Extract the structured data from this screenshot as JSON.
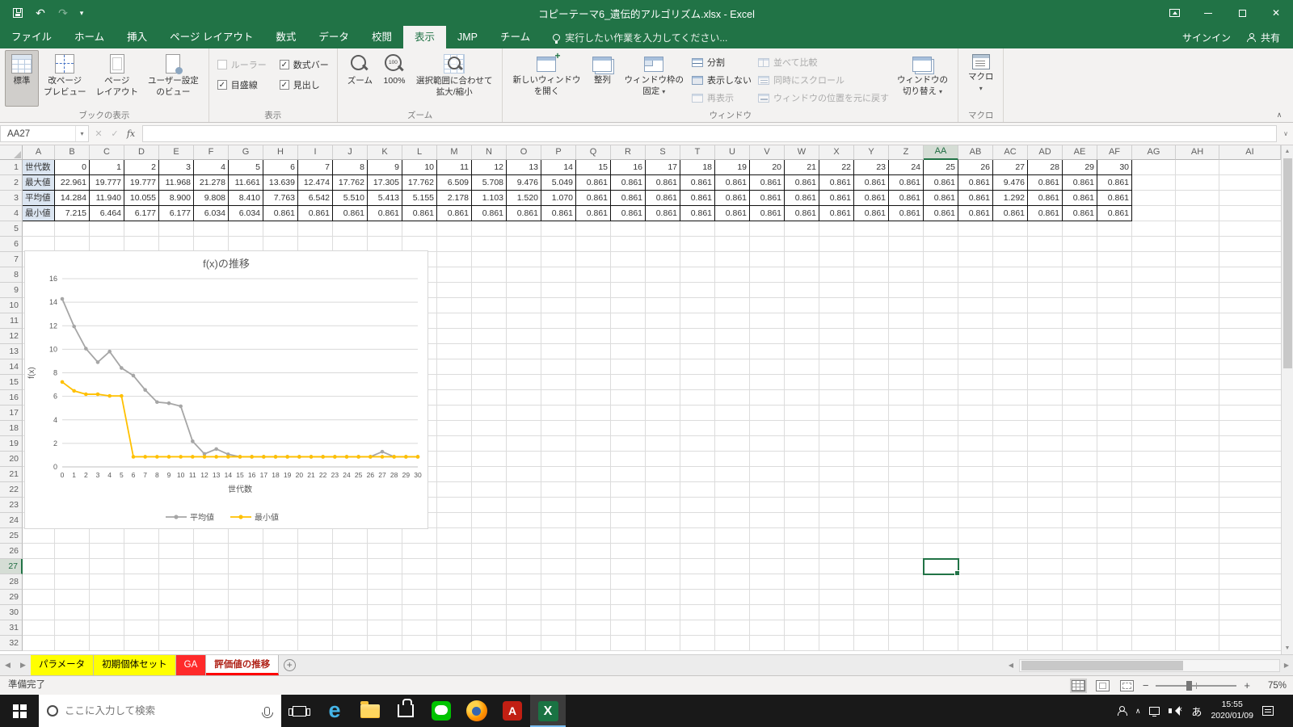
{
  "title_bar": {
    "title": "コピーテーマ6_遺伝的アルゴリズム.xlsx - Excel"
  },
  "ribbon_tabs": {
    "file": "ファイル",
    "home": "ホーム",
    "insert": "挿入",
    "page_layout": "ページ レイアウト",
    "formulas": "数式",
    "data": "データ",
    "review": "校閲",
    "view": "表示",
    "jmp": "JMP",
    "team": "チーム",
    "tell_me": "実行したい作業を入力してください...",
    "sign_in": "サインイン",
    "share": "共有"
  },
  "ribbon": {
    "book_views": {
      "label": "ブックの表示",
      "normal": "標準",
      "page_break_1": "改ページ",
      "page_break_2": "プレビュー",
      "page_layout_1": "ページ",
      "page_layout_2": "レイアウト",
      "custom_1": "ユーザー設定",
      "custom_2": "のビュー"
    },
    "show": {
      "label": "表示",
      "ruler": "ルーラー",
      "formula_bar": "数式バー",
      "gridlines": "目盛線",
      "headings": "見出し"
    },
    "zoom": {
      "label": "ズーム",
      "zoom": "ズーム",
      "hundred": "100%",
      "to_sel_1": "選択範囲に合わせて",
      "to_sel_2": "拡大/縮小"
    },
    "window": {
      "label": "ウィンドウ",
      "new_1": "新しいウィンドウ",
      "new_2": "を開く",
      "arrange": "整列",
      "freeze_1": "ウィンドウ枠の",
      "freeze_2": "固定",
      "split": "分割",
      "hide": "表示しない",
      "unhide": "再表示",
      "side_by_side": "並べて比較",
      "sync_scroll": "同時にスクロール",
      "reset_pos": "ウィンドウの位置を元に戻す",
      "switch_1": "ウィンドウの",
      "switch_2": "切り替え"
    },
    "macros": {
      "label": "マクロ",
      "macros": "マクロ"
    }
  },
  "formula_bar": {
    "name_box": "AA27",
    "formula": ""
  },
  "sheet": {
    "columns": [
      "A",
      "B",
      "C",
      "D",
      "E",
      "F",
      "G",
      "H",
      "I",
      "J",
      "K",
      "L",
      "M",
      "N",
      "O",
      "P",
      "Q",
      "R",
      "S",
      "T",
      "U",
      "V",
      "W",
      "X",
      "Y",
      "Z",
      "AA",
      "AB",
      "AC",
      "AD",
      "AE",
      "AF",
      "AG",
      "AH",
      "AI"
    ],
    "row_count": 32,
    "selected_cell": "AA27",
    "selected_column": "AA",
    "selected_row": 27,
    "table": {
      "header_label": "世代数",
      "row_labels": [
        "最大値",
        "平均値",
        "最小値"
      ],
      "generations": [
        0,
        1,
        2,
        3,
        4,
        5,
        6,
        7,
        8,
        9,
        10,
        11,
        12,
        13,
        14,
        15,
        16,
        17,
        18,
        19,
        20,
        21,
        22,
        23,
        24,
        25,
        26,
        27,
        28,
        29,
        30
      ],
      "values": [
        [
          "22.961",
          "19.777",
          "19.777",
          "11.968",
          "21.278",
          "11.661",
          "13.639",
          "12.474",
          "17.762",
          "17.305",
          "17.762",
          "6.509",
          "5.708",
          "9.476",
          "5.049",
          "0.861",
          "0.861",
          "0.861",
          "0.861",
          "0.861",
          "0.861",
          "0.861",
          "0.861",
          "0.861",
          "0.861",
          "0.861",
          "0.861",
          "9.476",
          "0.861",
          "0.861",
          "0.861"
        ],
        [
          "14.284",
          "11.940",
          "10.055",
          "8.900",
          "9.808",
          "8.410",
          "7.763",
          "6.542",
          "5.510",
          "5.413",
          "5.155",
          "2.178",
          "1.103",
          "1.520",
          "1.070",
          "0.861",
          "0.861",
          "0.861",
          "0.861",
          "0.861",
          "0.861",
          "0.861",
          "0.861",
          "0.861",
          "0.861",
          "0.861",
          "0.861",
          "1.292",
          "0.861",
          "0.861",
          "0.861"
        ],
        [
          "7.215",
          "6.464",
          "6.177",
          "6.177",
          "6.034",
          "6.034",
          "0.861",
          "0.861",
          "0.861",
          "0.861",
          "0.861",
          "0.861",
          "0.861",
          "0.861",
          "0.861",
          "0.861",
          "0.861",
          "0.861",
          "0.861",
          "0.861",
          "0.861",
          "0.861",
          "0.861",
          "0.861",
          "0.861",
          "0.861",
          "0.861",
          "0.861",
          "0.861",
          "0.861",
          "0.861"
        ]
      ]
    }
  },
  "chart_data": {
    "type": "line",
    "title": "f(x)の推移",
    "xlabel": "世代数",
    "ylabel": "f(x)",
    "xlim": [
      0,
      30
    ],
    "ylim": [
      0,
      16
    ],
    "ytick_step": 2,
    "grid": true,
    "legend_position": "bottom",
    "x": [
      0,
      1,
      2,
      3,
      4,
      5,
      6,
      7,
      8,
      9,
      10,
      11,
      12,
      13,
      14,
      15,
      16,
      17,
      18,
      19,
      20,
      21,
      22,
      23,
      24,
      25,
      26,
      27,
      28,
      29,
      30
    ],
    "series": [
      {
        "name": "平均値",
        "color": "#a6a6a6",
        "values": [
          14.284,
          11.94,
          10.055,
          8.9,
          9.808,
          8.41,
          7.763,
          6.542,
          5.51,
          5.413,
          5.155,
          2.178,
          1.103,
          1.52,
          1.07,
          0.861,
          0.861,
          0.861,
          0.861,
          0.861,
          0.861,
          0.861,
          0.861,
          0.861,
          0.861,
          0.861,
          0.861,
          1.292,
          0.861,
          0.861,
          0.861
        ]
      },
      {
        "name": "最小値",
        "color": "#ffc000",
        "values": [
          7.215,
          6.464,
          6.177,
          6.177,
          6.034,
          6.034,
          0.861,
          0.861,
          0.861,
          0.861,
          0.861,
          0.861,
          0.861,
          0.861,
          0.861,
          0.861,
          0.861,
          0.861,
          0.861,
          0.861,
          0.861,
          0.861,
          0.861,
          0.861,
          0.861,
          0.861,
          0.861,
          0.861,
          0.861,
          0.861,
          0.861
        ]
      }
    ]
  },
  "sheet_tabs": {
    "tabs": [
      {
        "label": "パラメータ",
        "color": "#ffff00",
        "text_color": "#000000"
      },
      {
        "label": "初期個体セット",
        "color": "#ffff00",
        "text_color": "#000000"
      },
      {
        "label": "GA",
        "color": "#ff2a2a",
        "text_color": "#ffffff"
      },
      {
        "label": "評価値の推移",
        "active": true,
        "accent": "#ff0000"
      }
    ]
  },
  "status_bar": {
    "ready": "準備完了",
    "zoom_level": "75%"
  },
  "taskbar": {
    "search_placeholder": "ここに入力して検索",
    "apps": [
      "edge",
      "file-explorer",
      "store",
      "green-app",
      "firefox",
      "acrobat",
      "excel"
    ],
    "active_app": "excel",
    "ime": "あ",
    "time": "15:55",
    "date": "2020/01/09"
  }
}
